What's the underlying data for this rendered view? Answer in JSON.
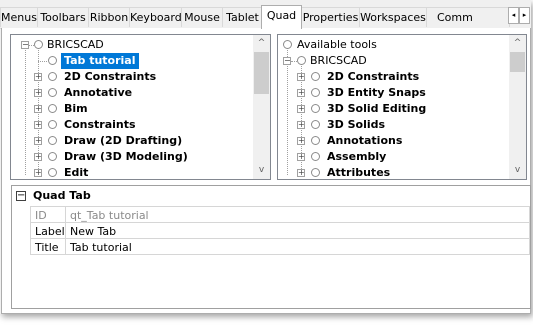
{
  "tabs": [
    "Menus",
    "Toolbars",
    "Ribbon",
    "Keyboard",
    "Mouse",
    "Tablet",
    "Quad",
    "Properties",
    "Workspaces",
    "Comm"
  ],
  "active_tab": "Quad",
  "tab_scroll": {
    "left": "◂",
    "right": "▸"
  },
  "left_tree": {
    "root": "BRICSCAD",
    "selected": "Tab tutorial",
    "items": [
      "2D Constraints",
      "Annotative",
      "Bim",
      "Constraints",
      "Draw (2D Drafting)",
      "Draw (3D Modeling)",
      "Edit"
    ]
  },
  "right_tree": {
    "top": "Available tools",
    "root": "BRICSCAD",
    "items": [
      "2D Constraints",
      "3D Entity Snaps",
      "3D Solid Editing",
      "3D Solids",
      "Annotations",
      "Assembly",
      "Attributes"
    ]
  },
  "scroll": {
    "up": "^",
    "down": "v"
  },
  "properties": {
    "title": "Quad Tab",
    "collapse_glyph": "−",
    "rows": [
      {
        "key": "ID",
        "value": "qt_Tab tutorial",
        "disabled": true
      },
      {
        "key": "Label",
        "value": "New Tab",
        "disabled": false
      },
      {
        "key": "Title",
        "value": "Tab tutorial",
        "disabled": false
      }
    ]
  }
}
